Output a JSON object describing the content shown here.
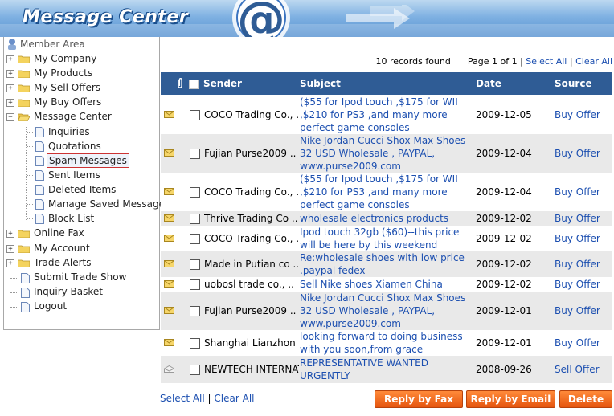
{
  "banner": {
    "title": "Message Center"
  },
  "tree": {
    "root_label": "Member Area",
    "items": [
      {
        "label": "My Company",
        "type": "folder"
      },
      {
        "label": "My Products",
        "type": "folder"
      },
      {
        "label": "My Sell Offers",
        "type": "folder"
      },
      {
        "label": "My Buy Offers",
        "type": "folder"
      },
      {
        "label": "Message Center",
        "type": "folder-open"
      },
      {
        "label": "Inquiries",
        "type": "page"
      },
      {
        "label": "Quotations",
        "type": "page"
      },
      {
        "label": "Spam Messages",
        "type": "page",
        "selected": true
      },
      {
        "label": "Sent Items",
        "type": "page"
      },
      {
        "label": "Deleted Items",
        "type": "page"
      },
      {
        "label": "Manage Saved Messages",
        "type": "page"
      },
      {
        "label": "Block List",
        "type": "page"
      },
      {
        "label": "Online Fax",
        "type": "folder"
      },
      {
        "label": "My Account",
        "type": "folder"
      },
      {
        "label": "Trade Alerts",
        "type": "folder"
      },
      {
        "label": "Submit Trade Show",
        "type": "page"
      },
      {
        "label": "Inquiry Basket",
        "type": "page"
      },
      {
        "label": "Logout",
        "type": "page"
      }
    ]
  },
  "toolbar": {
    "records": "10 records found",
    "page": "Page 1 of 1",
    "sep": "|",
    "select_all": "Select All",
    "clear_all": "Clear All"
  },
  "table": {
    "headers": {
      "sender": "Sender",
      "subject": "Subject",
      "date": "Date",
      "source": "Source"
    },
    "rows": [
      {
        "sender": "COCO Trading Co., ..",
        "subject": "($55 for Ipod touch ,$175 for WII ,$210 for PS3 ,and many more perfect game consoles",
        "date": "2009-12-05",
        "source": "Buy Offer",
        "read": false
      },
      {
        "sender": "Fujian Purse2009 ..",
        "subject": "Nike Jordan Cucci Shox Max Shoes 32 USD Wholesale , PAYPAL, www.purse2009.com",
        "date": "2009-12-04",
        "source": "Buy Offer",
        "read": false
      },
      {
        "sender": "COCO Trading Co., ..",
        "subject": "($55 for Ipod touch ,$175 for WII ,$210 for PS3 ,and many more perfect game consoles",
        "date": "2009-12-04",
        "source": "Buy Offer",
        "read": false
      },
      {
        "sender": "Thrive Trading Co ..",
        "subject": "wholesale electronics products",
        "date": "2009-12-02",
        "source": "Buy Offer",
        "read": false
      },
      {
        "sender": "COCO Trading Co., ..",
        "subject": "Ipod touch 32gb ($60)--this price will be here by this weekend",
        "date": "2009-12-02",
        "source": "Buy Offer",
        "read": false
      },
      {
        "sender": "Made in Putian co ..",
        "subject": "Re:wholesale shoes with low price .paypal fedex",
        "date": "2009-12-02",
        "source": "Buy Offer",
        "read": false
      },
      {
        "sender": "uobosl trade co., ..",
        "subject": "Sell Nike shoes Xiamen China",
        "date": "2009-12-02",
        "source": "Buy Offer",
        "read": false
      },
      {
        "sender": "Fujian Purse2009 ..",
        "subject": "Nike Jordan Cucci Shox Max Shoes 32 USD Wholesale , PAYPAL, www.purse2009.com",
        "date": "2009-12-01",
        "source": "Buy Offer",
        "read": false
      },
      {
        "sender": "Shanghai Lianzhon ..",
        "subject": "looking forward to doing business with you soon,from grace",
        "date": "2009-12-01",
        "source": "Buy Offer",
        "read": false
      },
      {
        "sender": "NEWTECH INTERNATI ..",
        "subject": "REPRESENTATIVE WANTED URGENTLY",
        "date": "2008-09-26",
        "source": "Sell Offer",
        "read": true
      }
    ]
  },
  "footer": {
    "select_all": "Select All",
    "sep": "|",
    "clear_all": "Clear All",
    "reply_fax": "Reply by Fax",
    "reply_email": "Reply by Email",
    "delete": "Delete"
  },
  "colors": {
    "header_bg": "#2f5c95",
    "link": "#1c4fb0",
    "button": "#e5550f",
    "row_alt": "#e9e9e9"
  }
}
